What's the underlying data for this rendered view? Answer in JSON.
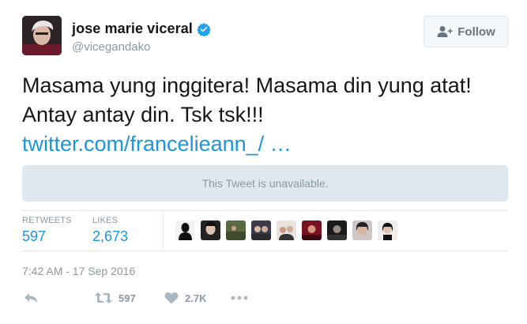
{
  "user": {
    "display_name": "jose marie viceral",
    "handle": "@vicegandako",
    "verified_icon": "verified-badge-icon",
    "avatar_icon": "avatar"
  },
  "follow_button": {
    "label": "Follow",
    "icon": "add-user-icon"
  },
  "tweet": {
    "text_line_1": "Masama yung inggitera! Masama din yung atat!",
    "text_line_2": "Antay antay din. Tsk tsk!!!",
    "link": "twitter.com/francelieann_/ …"
  },
  "quoted": {
    "notice": "This Tweet is unavailable."
  },
  "stats": {
    "retweets_label": "RETWEETS",
    "retweets_value": "597",
    "likes_label": "LIKES",
    "likes_value": "2,673",
    "liker_avatar_count": 9
  },
  "timestamp": "7:42 AM - 17 Sep 2016",
  "actions": {
    "reply_icon": "reply-icon",
    "retweet_icon": "retweet-icon",
    "retweet_count": "597",
    "like_icon": "heart-icon",
    "like_count": "2.7K",
    "more_icon": "more-icon"
  },
  "colors": {
    "accent": "#1b95e0",
    "muted": "#8899a6",
    "text": "#14171a",
    "border": "#e1e8ed"
  }
}
